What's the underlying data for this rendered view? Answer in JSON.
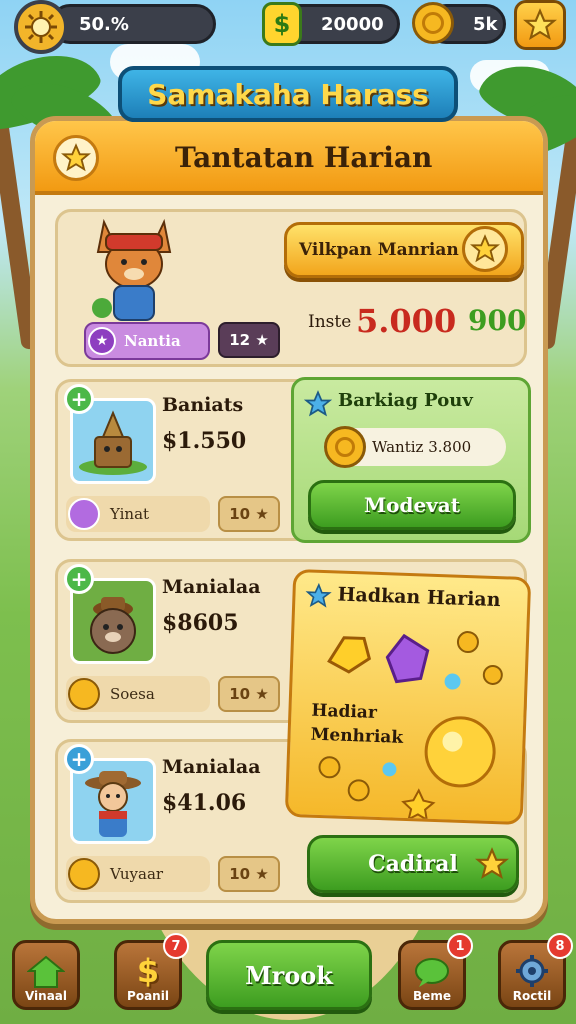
{
  "hud": {
    "settings_icon": "sun-gear-icon",
    "progress_text": "50.%",
    "cash_symbol": "$",
    "cash_value": "20000",
    "coin_value": "5k",
    "star_icon": "star-icon"
  },
  "banner": {
    "title": "Samakaha Harass"
  },
  "panel": {
    "title": "Tantatan Harian",
    "title_icon": "star-icon"
  },
  "featured": {
    "character_icon": "fox-character-icon",
    "tag_label": "Nantia",
    "badge_text": "12 ★",
    "reward_button_label": "Vilkpan Manrian",
    "price_label": "Inste",
    "price_value": "5.000",
    "bonus_value": "900"
  },
  "rows": [
    {
      "name": "Baniats",
      "price": "$1.550",
      "tag": "Yinat",
      "badge": "10 ★",
      "icon": "tree-stump-icon",
      "tag_icon": "purple-gem-icon"
    },
    {
      "name": "Manialaa",
      "price": "$8605",
      "tag": "Soesa",
      "badge": "10 ★",
      "icon": "mole-character-icon",
      "tag_icon": "coin-icon"
    },
    {
      "name": "Manialaa",
      "price": "$41.06",
      "tag": "Vuyaar",
      "badge": "10 ★",
      "icon": "explorer-character-icon",
      "tag_icon": "coin-icon"
    }
  ],
  "ranking": {
    "title": "Barkiag Pouv",
    "coin_label": "Wantiz 3.800",
    "button_label": "Modevat"
  },
  "daily_reward": {
    "title": "Hadkan Harian",
    "subtitle_line1": "Hadiar",
    "subtitle_line2": "Menhriak"
  },
  "claim_button": {
    "label": "Cadiral"
  },
  "bottom_nav": [
    {
      "label": "Vinaal",
      "icon": "house-icon",
      "badge": ""
    },
    {
      "label": "Poanil",
      "icon": "dollar-icon",
      "badge": "7"
    },
    {
      "label": "Mrook",
      "icon": "",
      "badge": ""
    },
    {
      "label": "Beme",
      "icon": "chat-bubble-icon",
      "badge": "1"
    },
    {
      "label": "Roctil",
      "icon": "gear-icon",
      "badge": "8"
    }
  ],
  "colors": {
    "accent_orange": "#f29a12",
    "accent_green": "#3d9d20",
    "panel_bg": "#f7efd8",
    "banner_blue": "#1d7fb8"
  }
}
